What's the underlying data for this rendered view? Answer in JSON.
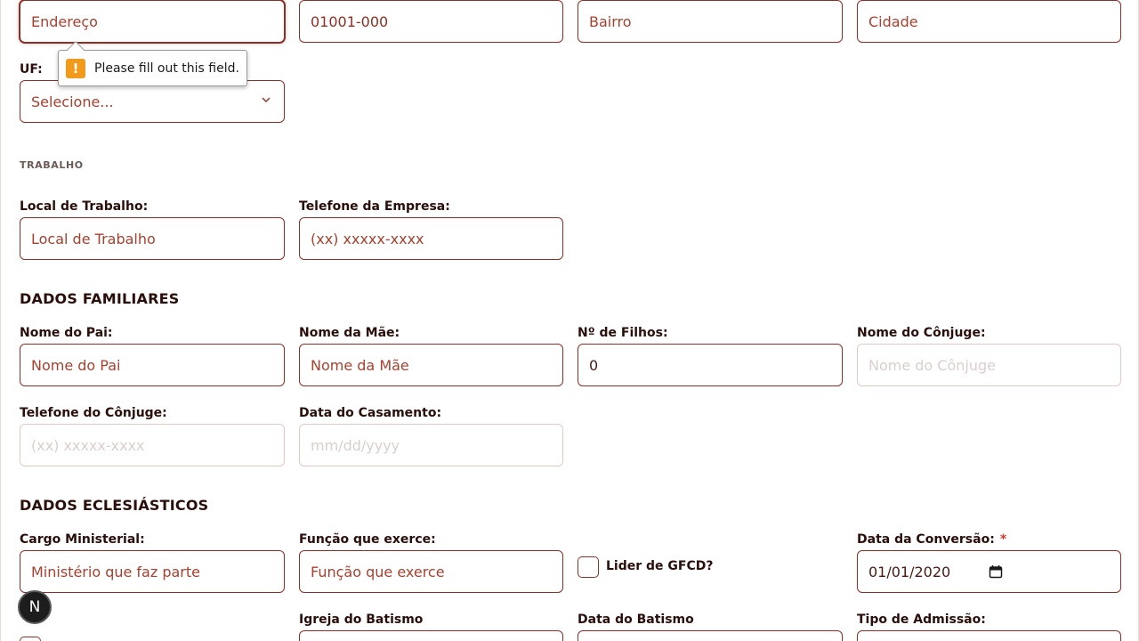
{
  "address": {
    "endereco_placeholder": "Endereço",
    "cep_value": "01001-000",
    "bairro_placeholder": "Bairro",
    "cidade_placeholder": "Cidade",
    "uf_label": "UF:",
    "uf_selected": "Selecione...",
    "validation_message": "Please fill out this field."
  },
  "work": {
    "section_title": "TRABALHO",
    "local_label": "Local de Trabalho:",
    "local_placeholder": "Local de Trabalho",
    "phone_label": "Telefone da Empresa:",
    "phone_placeholder": "(xx) xxxxx-xxxx"
  },
  "family": {
    "section_title": "DADOS FAMILIARES",
    "pai_label": "Nome do Pai:",
    "pai_placeholder": "Nome do Pai",
    "mae_label": "Nome da Mãe:",
    "mae_placeholder": "Nome da Mãe",
    "filhos_label": "Nº de Filhos:",
    "filhos_value": "0",
    "conjuge_label": "Nome do Cônjuge:",
    "conjuge_placeholder": "Nome do Cônjuge",
    "tel_conjuge_label": "Telefone do Cônjuge:",
    "tel_conjuge_placeholder": "(xx) xxxxx-xxxx",
    "casamento_label": "Data do Casamento:",
    "casamento_placeholder": "mm/dd/yyyy"
  },
  "church": {
    "section_title": "DADOS ECLESIÁSTICOS",
    "cargo_label": "Cargo Ministerial:",
    "cargo_placeholder": "Ministério que faz parte",
    "funcao_label": "Função que exerce:",
    "funcao_placeholder": "Função que exerce",
    "lider_label": "Lider de GFCD?",
    "conversao_label": "Data da Conversão:",
    "conversao_required": "*",
    "conversao_value": "01/01/2020",
    "igreja_batismo_label": "Igreja do Batismo",
    "data_batismo_label": "Data do Batismo",
    "admissao_label": "Tipo de Admissão:"
  },
  "badge": {
    "letter": "N"
  },
  "icons": {
    "warning": "warning-icon",
    "chevron": "chevron-down-icon",
    "calendar": "calendar-icon"
  }
}
